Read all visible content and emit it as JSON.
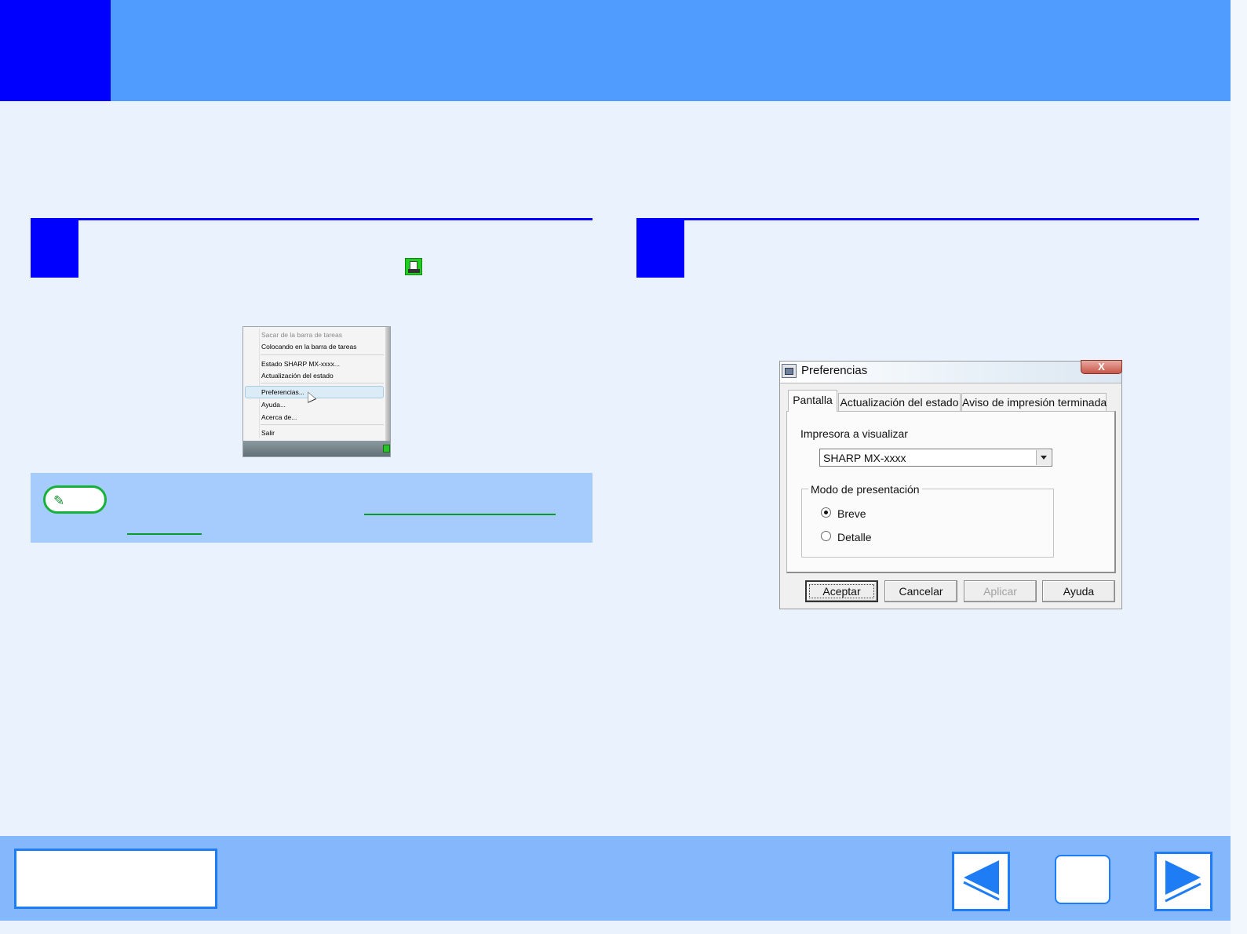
{
  "context_menu": {
    "items": [
      {
        "label": "Sacar de la barra de tareas",
        "disabled": true
      },
      {
        "label": "Colocando en la barra de tareas",
        "disabled": false
      },
      {
        "label": "Estado SHARP MX-xxxx...",
        "disabled": false
      },
      {
        "label": "Actualización del estado",
        "disabled": false
      },
      {
        "label": "Preferencias...",
        "disabled": false,
        "highlighted": true
      },
      {
        "label": "Ayuda...",
        "disabled": false
      },
      {
        "label": "Acerca de...",
        "disabled": false
      },
      {
        "label": "Salir",
        "disabled": false
      }
    ]
  },
  "dialog": {
    "title": "Preferencias",
    "close_glyph": "X",
    "tabs": [
      "Pantalla",
      "Actualización del estado",
      "Aviso de impresión terminada"
    ],
    "active_tab": "Pantalla",
    "printer_label": "Impresora a visualizar",
    "printer_value": "SHARP MX-xxxx",
    "mode_group_label": "Modo de presentación",
    "mode_options": [
      "Breve",
      "Detalle"
    ],
    "mode_selected": "Breve",
    "buttons": {
      "ok": "Aceptar",
      "cancel": "Cancelar",
      "apply": "Aplicar",
      "help": "Ayuda"
    }
  },
  "colors": {
    "header": "#4f9bfe",
    "accent_blue": "#0000ff",
    "memo_bg": "#a6cbfd",
    "memo_green": "#17b13a",
    "footer": "#85b7fd",
    "nav_border": "#1e7cf5"
  },
  "icons": {
    "tray_icon": "printer-status-icon",
    "memo_icon": "pencil-icon",
    "prev": "arrow-left-icon",
    "next": "arrow-right-icon"
  }
}
